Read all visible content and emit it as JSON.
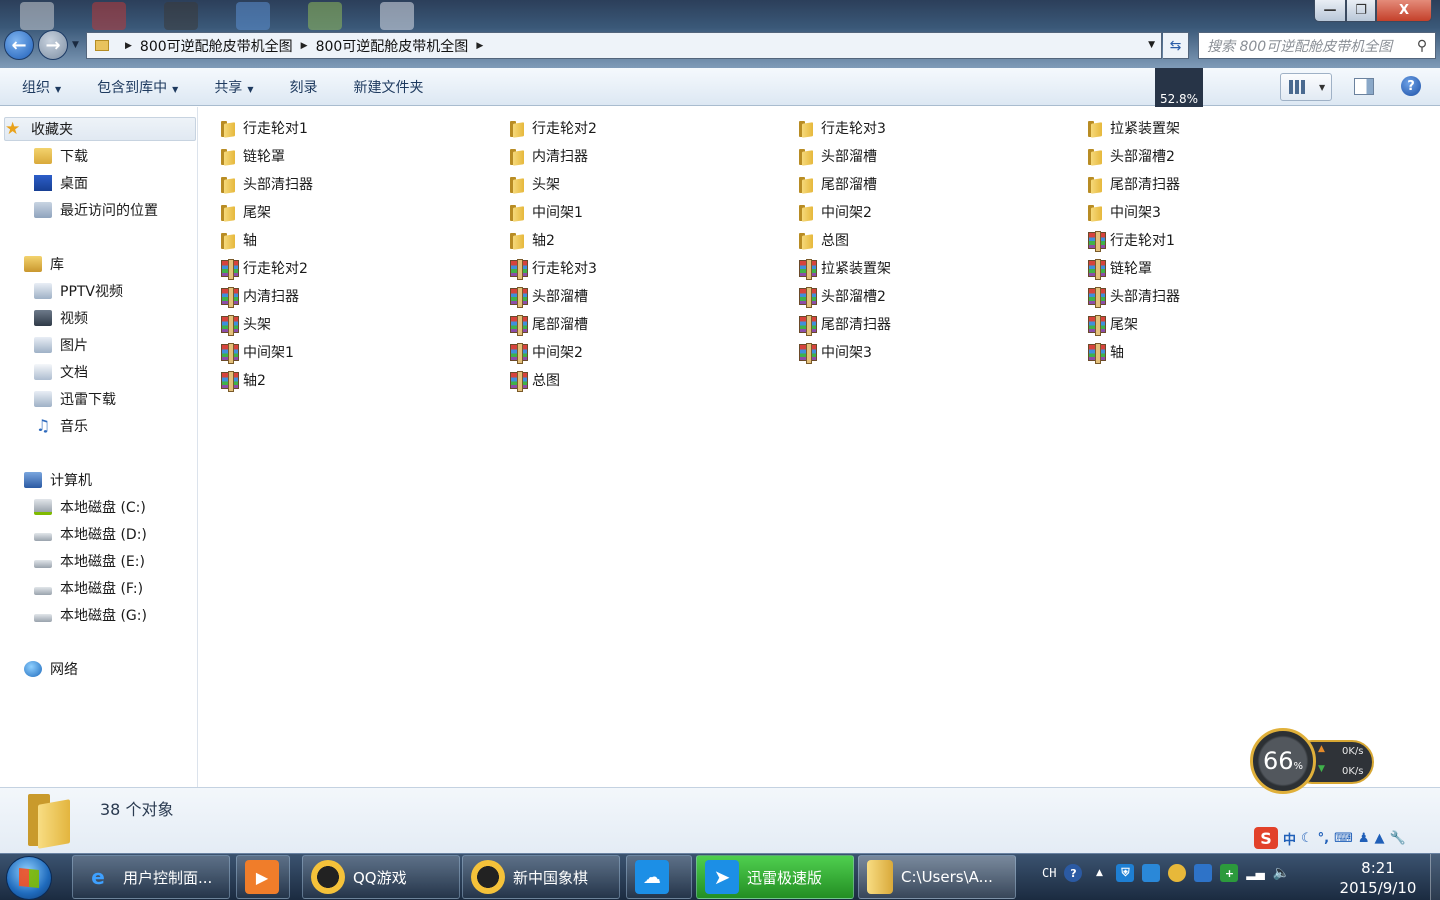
{
  "window": {
    "close_label": "X",
    "back_label": "←",
    "forward_label": "→"
  },
  "address": {
    "crumbs": [
      "800可逆配舱皮带机全图",
      "800可逆配舱皮带机全图"
    ]
  },
  "search": {
    "placeholder": "搜索 800可逆配舱皮带机全图"
  },
  "toolbar": {
    "organize": "组织",
    "include_library": "包含到库中",
    "share": "共享",
    "burn": "刻录",
    "new_folder": "新建文件夹",
    "zoom_tip": "52.8%"
  },
  "nav": {
    "favorites": "收藏夹",
    "downloads": "下载",
    "desktop": "桌面",
    "recent": "最近访问的位置",
    "libraries": "库",
    "pptv": "PPTV视频",
    "videos": "视频",
    "pictures": "图片",
    "documents": "文档",
    "xunlei": "迅雷下载",
    "music": "音乐",
    "computer": "计算机",
    "drive_c": "本地磁盘 (C:)",
    "drive_d": "本地磁盘 (D:)",
    "drive_e": "本地磁盘 (E:)",
    "drive_f": "本地磁盘 (F:)",
    "drive_g": "本地磁盘 (G:)",
    "network": "网络"
  },
  "files": [
    {
      "name": "行走轮对1",
      "type": "folder"
    },
    {
      "name": "行走轮对2",
      "type": "folder"
    },
    {
      "name": "行走轮对3",
      "type": "folder"
    },
    {
      "name": "拉紧装置架",
      "type": "folder"
    },
    {
      "name": "链轮罩",
      "type": "folder"
    },
    {
      "name": "内清扫器",
      "type": "folder"
    },
    {
      "name": "头部溜槽",
      "type": "folder"
    },
    {
      "name": "头部溜槽2",
      "type": "folder"
    },
    {
      "name": "头部清扫器",
      "type": "folder"
    },
    {
      "name": "头架",
      "type": "folder"
    },
    {
      "name": "尾部溜槽",
      "type": "folder"
    },
    {
      "name": "尾部清扫器",
      "type": "folder"
    },
    {
      "name": "尾架",
      "type": "folder"
    },
    {
      "name": "中间架1",
      "type": "folder"
    },
    {
      "name": "中间架2",
      "type": "folder"
    },
    {
      "name": "中间架3",
      "type": "folder"
    },
    {
      "name": "轴",
      "type": "folder"
    },
    {
      "name": "轴2",
      "type": "folder"
    },
    {
      "name": "总图",
      "type": "folder"
    },
    {
      "name": "行走轮对1",
      "type": "archive"
    },
    {
      "name": "行走轮对2",
      "type": "archive"
    },
    {
      "name": "行走轮对3",
      "type": "archive"
    },
    {
      "name": "拉紧装置架",
      "type": "archive"
    },
    {
      "name": "链轮罩",
      "type": "archive"
    },
    {
      "name": "内清扫器",
      "type": "archive"
    },
    {
      "name": "头部溜槽",
      "type": "archive"
    },
    {
      "name": "头部溜槽2",
      "type": "archive"
    },
    {
      "name": "头部清扫器",
      "type": "archive"
    },
    {
      "name": "头架",
      "type": "archive"
    },
    {
      "name": "尾部溜槽",
      "type": "archive"
    },
    {
      "name": "尾部清扫器",
      "type": "archive"
    },
    {
      "name": "尾架",
      "type": "archive"
    },
    {
      "name": "中间架1",
      "type": "archive"
    },
    {
      "name": "中间架2",
      "type": "archive"
    },
    {
      "name": "中间架3",
      "type": "archive"
    },
    {
      "name": "轴",
      "type": "archive"
    },
    {
      "name": "轴2",
      "type": "archive"
    },
    {
      "name": "总图",
      "type": "archive"
    }
  ],
  "details": {
    "count_text": "38 个对象"
  },
  "speed_widget": {
    "percent": "66",
    "percent_sign": "%",
    "up": "0K/s",
    "down": "0K/s"
  },
  "ime": {
    "logo": "S",
    "mode": "中"
  },
  "taskbar": {
    "items": [
      {
        "label": "用户控制面..."
      },
      {
        "label": ""
      },
      {
        "label": "QQ游戏"
      },
      {
        "label": "新中国象棋"
      },
      {
        "label": ""
      },
      {
        "label": "迅雷极速版"
      },
      {
        "label": "C:\\Users\\A..."
      }
    ],
    "lang": "CH",
    "time": "8:21",
    "date": "2015/9/10"
  }
}
